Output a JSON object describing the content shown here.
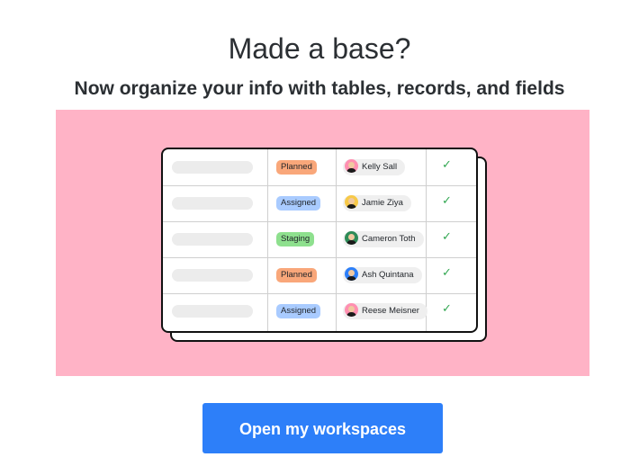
{
  "title": "Made a base?",
  "subtitle": "Now organize your info with tables, records, and fields",
  "banner": {
    "background_color": "#ffb3c6"
  },
  "table": {
    "rows": [
      {
        "status": "Planned",
        "status_color": "#f9a77a",
        "person": "Kelly Sall",
        "avatar_color": "#ff8fb1"
      },
      {
        "status": "Assigned",
        "status_color": "#a9cbff",
        "person": "Jamie Ziya",
        "avatar_color": "#f7c948"
      },
      {
        "status": "Staging",
        "status_color": "#8ee08e",
        "person": "Cameron Toth",
        "avatar_color": "#2e8b57"
      },
      {
        "status": "Planned",
        "status_color": "#f9a77a",
        "person": "Ash Quintana",
        "avatar_color": "#2d7ff9"
      },
      {
        "status": "Assigned",
        "status_color": "#a9cbff",
        "person": "Reese Meisner",
        "avatar_color": "#ff8fb1"
      }
    ],
    "check_icon": "check-icon",
    "check_color": "#34a853"
  },
  "cta": {
    "label": "Open my workspaces",
    "color": "#2d7ff9"
  }
}
